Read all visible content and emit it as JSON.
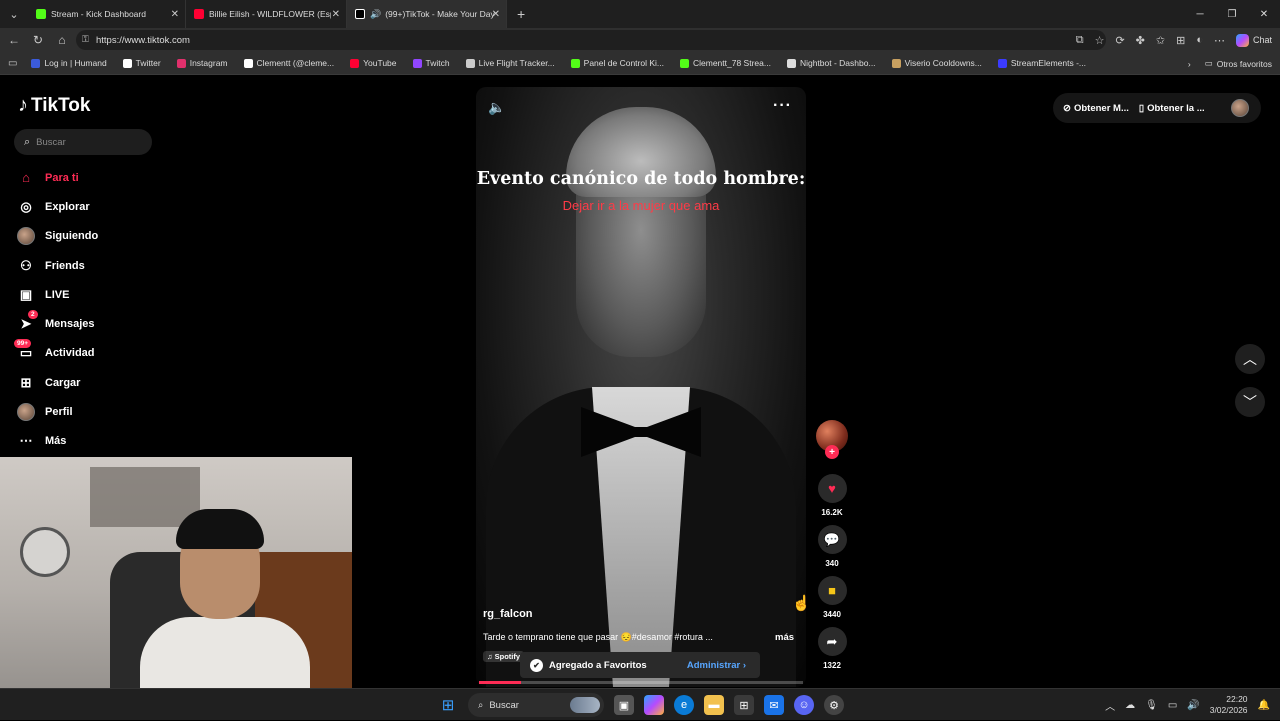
{
  "browser": {
    "tabs": [
      {
        "title": "Stream - Kick Dashboard",
        "color": "#53fc18"
      },
      {
        "title": "Billie Eilish - WILDFLOWER (Españ",
        "color": "#ff0033"
      },
      {
        "title": "(99+)TikTok - Make Your Day",
        "color": "#ffffff"
      }
    ],
    "url": "https://www.tiktok.com",
    "chat_label": "Chat",
    "bookmarks": [
      {
        "label": "Log in | Humand",
        "color": "#3b5bdb"
      },
      {
        "label": "Twitter",
        "color": "#ffffff"
      },
      {
        "label": "Instagram",
        "color": "#e1306c"
      },
      {
        "label": "Clementt (@cleme...",
        "color": "#ffffff"
      },
      {
        "label": "YouTube",
        "color": "#ff0033"
      },
      {
        "label": "Twitch",
        "color": "#9146ff"
      },
      {
        "label": "Live Flight Tracker...",
        "color": "#cccccc"
      },
      {
        "label": "Panel de Control Ki...",
        "color": "#53fc18"
      },
      {
        "label": "Clementt_78 Strea...",
        "color": "#53fc18"
      },
      {
        "label": "Nightbot - Dashbo...",
        "color": "#dddddd"
      },
      {
        "label": "Viserio Cooldowns...",
        "color": "#c8a060"
      },
      {
        "label": "StreamElements -...",
        "color": "#3b3bff"
      }
    ],
    "other_bookmarks": "Otros favoritos"
  },
  "tiktok": {
    "logo": "TikTok",
    "search_placeholder": "Buscar",
    "nav": [
      {
        "label": "Para ti",
        "icon": "home-icon"
      },
      {
        "label": "Explorar",
        "icon": "compass-icon"
      },
      {
        "label": "Siguiendo",
        "icon": "following-avatar-icon"
      },
      {
        "label": "Friends",
        "icon": "friends-icon"
      },
      {
        "label": "LIVE",
        "icon": "live-icon"
      },
      {
        "label": "Mensajes",
        "icon": "messages-icon",
        "badge": "2"
      },
      {
        "label": "Actividad",
        "icon": "activity-icon",
        "badge": "99+"
      },
      {
        "label": "Cargar",
        "icon": "upload-icon"
      },
      {
        "label": "Perfil",
        "icon": "profile-avatar-icon"
      },
      {
        "label": "Más",
        "icon": "more-icon"
      }
    ],
    "top_right": {
      "get_coins": "Obtener M...",
      "get_app": "Obtener la ..."
    },
    "video": {
      "overlay_title": "Evento canónico de todo hombre:",
      "overlay_subtitle": "Dejar ir a la mujer que ama",
      "username": "rg_falcon",
      "description": "Tarde o temprano tiene que pasar 😔#desamor #rotura ...",
      "more": "más",
      "music": "Spotify",
      "progress": 0.13
    },
    "actions": {
      "likes": "16.2K",
      "comments": "340",
      "saves": "3440",
      "shares": "1322"
    },
    "toast": {
      "message": "Agregado a Favoritos",
      "action": "Administrar"
    }
  },
  "taskbar": {
    "search": "Buscar",
    "time": "22:20",
    "date": "3/02/2026"
  }
}
